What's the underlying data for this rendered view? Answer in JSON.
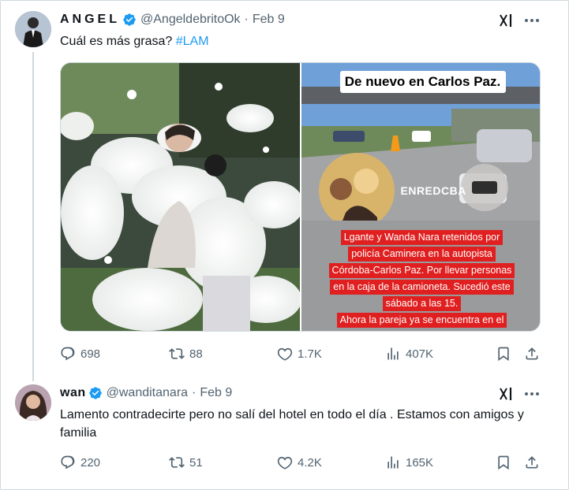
{
  "tweet1": {
    "display_name": "ANGEL",
    "handle": "@AngeldebritoOk",
    "separator": "·",
    "date": "Feb 9",
    "text_plain": "Cuál es más grasa? ",
    "hashtag": "#LAM",
    "media": {
      "right_title": "De nuevo en Carlos Paz.",
      "right_watermark": "ENREDCBA",
      "right_caption_lines": [
        "Lgante y Wanda Nara retenidos por",
        "policía Caminera en la autopista",
        "Córdoba-Carlos Paz. Por llevar personas",
        "en la caja de la camioneta. Sucedió este",
        "sábado a las 15.",
        "Ahora la pareja ya se encuentra en el"
      ]
    },
    "stats": {
      "replies": "698",
      "reposts": "88",
      "likes": "1.7K",
      "views": "407K"
    }
  },
  "tweet2": {
    "display_name": "wan",
    "handle": "@wanditanara",
    "separator": "·",
    "date": "Feb 9",
    "text": "Lamento contradecirte pero no salí del hotel en todo el día . Estamos con amigos y familia",
    "stats": {
      "replies": "220",
      "reposts": "51",
      "likes": "4.2K",
      "views": "165K"
    }
  },
  "colors": {
    "accent": "#1d9bf0",
    "secondary_text": "#536471",
    "border": "#cfd9de",
    "caption_red": "#e02020"
  },
  "icons": [
    "verified-badge-icon",
    "grok-icon",
    "more-icon",
    "reply-icon",
    "repost-icon",
    "like-icon",
    "views-icon",
    "bookmark-icon",
    "share-icon"
  ]
}
